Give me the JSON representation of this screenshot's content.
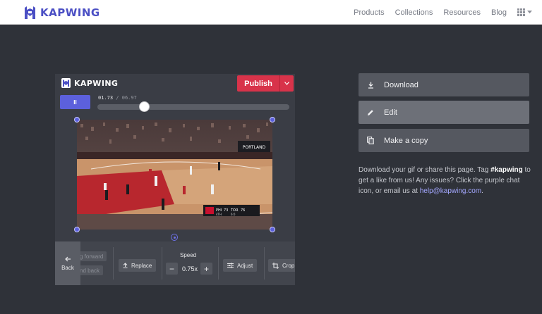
{
  "nav": {
    "brand": "KAPWING",
    "links": [
      "Products",
      "Collections",
      "Resources",
      "Blog"
    ],
    "grid_icon": "grid-icon",
    "caret_icon": "caret-down-icon"
  },
  "editor": {
    "brand": "KAPWING",
    "publish_label": "Publish",
    "pause_symbol": "II",
    "time_current": "01.73",
    "time_separator": "/",
    "time_total": "06.97",
    "progress_fraction": 0.248
  },
  "toolbar": {
    "back_label": "Back",
    "faded_1": "g forward",
    "faded_2": "nd back",
    "replace_label": "Replace",
    "speed_label": "Speed",
    "speed_minus": "−",
    "speed_value": "0.75x",
    "speed_plus": "+",
    "adjust_label": "Adjust",
    "crop_label": "Crop"
  },
  "actions": {
    "download_label": "Download",
    "edit_label": "Edit",
    "copy_label": "Make a copy"
  },
  "info": {
    "line_start": "Download your gif or share this page. Tag ",
    "hashtag": "#kapwing",
    "line_mid": " to get a like from us! Any issues? Click the purple chat icon, or email us at ",
    "email": "help@kapwing.com",
    "line_end": "."
  },
  "scoreboard": {
    "team_a": "PHI",
    "score_a": "73",
    "team_b": "TOR",
    "score_b": "76",
    "period": "4TH",
    "clock": "6:0"
  },
  "colors": {
    "brand_purple": "#4b4fc4",
    "accent": "#5c60dc",
    "publish_red": "#d8334a",
    "background": "#2f3239"
  }
}
